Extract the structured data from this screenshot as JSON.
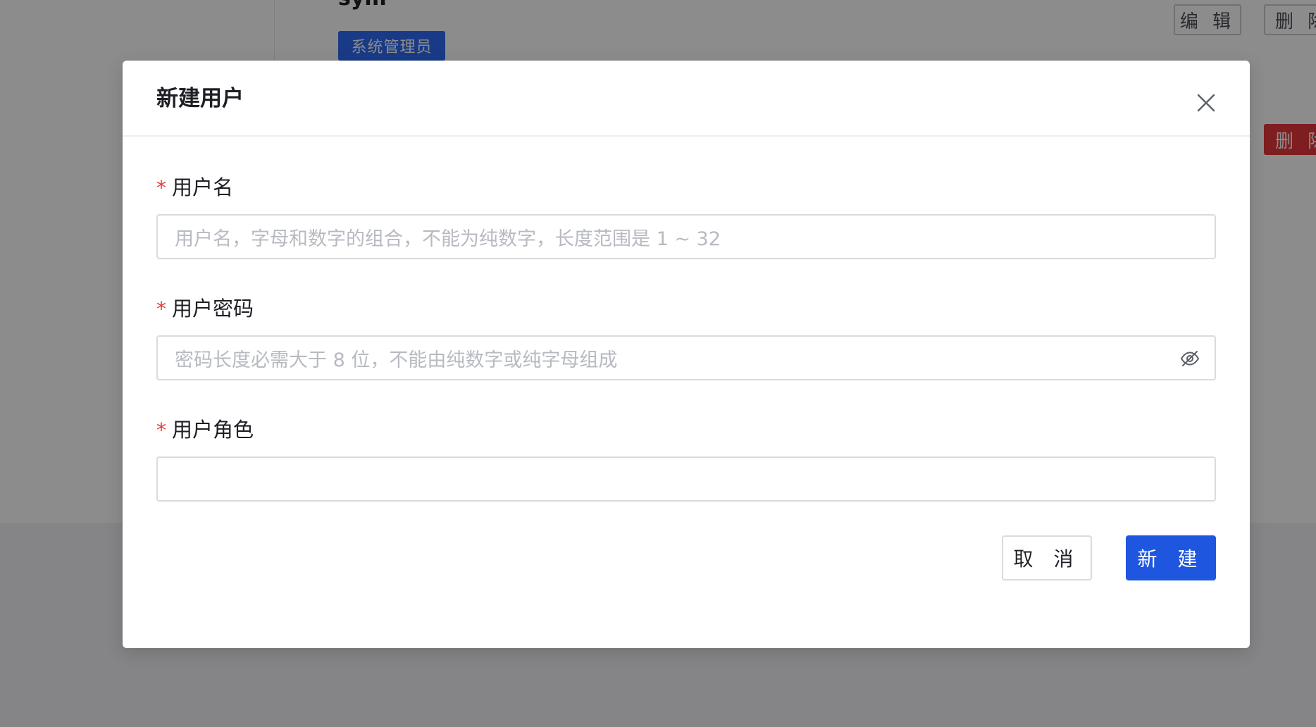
{
  "background": {
    "user_name": "sym",
    "role_tag": "系统管理员",
    "edit_button": "编 辑",
    "delete_button": "删 除",
    "delete_button_2": "删 除"
  },
  "dialog": {
    "title": "新建用户",
    "close_icon": "close-icon",
    "fields": {
      "username": {
        "required_mark": "*",
        "label": "用户名",
        "placeholder": "用户名，字母和数字的组合，不能为纯数字，长度范围是 1 ~ 32",
        "value": ""
      },
      "password": {
        "required_mark": "*",
        "label": "用户密码",
        "placeholder": "密码长度必需大于 8 位，不能由纯数字或纯字母组成",
        "value": "",
        "visibility_icon": "eye-slash-icon"
      },
      "role": {
        "required_mark": "*",
        "label": "用户角色",
        "value": ""
      }
    },
    "buttons": {
      "cancel": "取 消",
      "create": "新 建"
    }
  },
  "colors": {
    "primary": "#1f56e0",
    "danger": "#e5383b",
    "role_tag": "#2f6cf6"
  }
}
